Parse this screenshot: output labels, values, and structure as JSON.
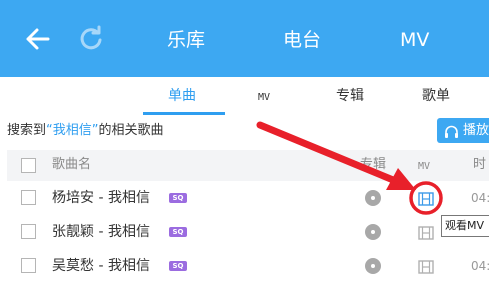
{
  "header": {
    "back_icon": "back-arrow-icon",
    "refresh_icon": "refresh-icon",
    "tabs": [
      {
        "label": "乐库"
      },
      {
        "label": "电台"
      },
      {
        "label": "MV"
      }
    ],
    "background_color": "#3da8f2"
  },
  "subtabs": {
    "items": [
      {
        "label": "单曲",
        "active": true
      },
      {
        "label": "MV"
      },
      {
        "label": "专辑"
      },
      {
        "label": "歌单"
      }
    ],
    "accent_color": "#2f9ef0"
  },
  "search_info": {
    "prefix": "搜索到",
    "keyword": "“我相信”",
    "suffix": "的相关歌曲"
  },
  "play_button": {
    "label": "播放",
    "icon": "headphones-icon"
  },
  "table": {
    "headers": {
      "name": "歌曲名",
      "album": "专辑",
      "mv": "MV",
      "time": "时"
    },
    "rows": [
      {
        "title": "杨培安 - 我相信",
        "quality_badge": "SQ",
        "time": "04:"
      },
      {
        "title": "张靓颖 - 我相信",
        "quality_badge": "SQ",
        "time": "04:"
      },
      {
        "title": "吴莫愁 - 我相信",
        "quality_badge": "SQ",
        "time": "04:"
      }
    ]
  },
  "tooltip": {
    "text": "观看MV"
  },
  "annotation_color": "#e8202a"
}
